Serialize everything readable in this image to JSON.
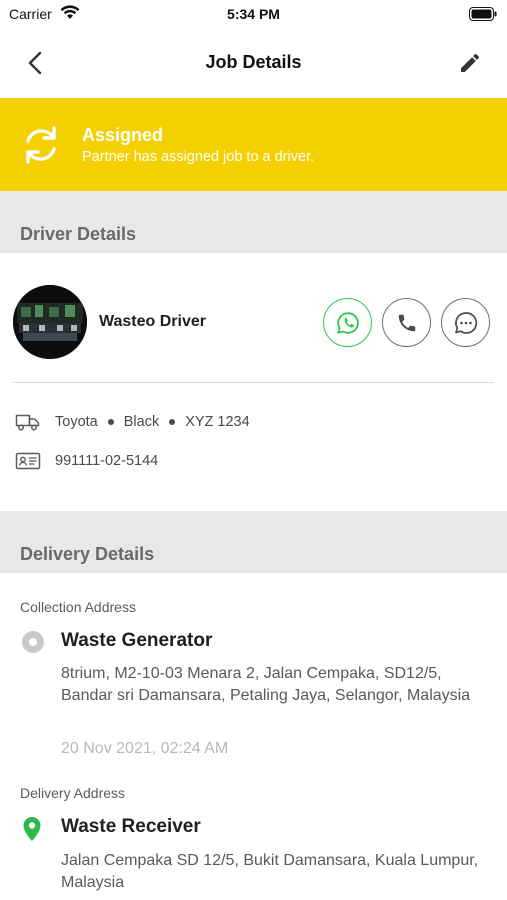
{
  "status_bar": {
    "carrier": "Carrier",
    "time": "5:34 PM"
  },
  "nav": {
    "title": "Job Details",
    "back_icon": "chevron-left-icon",
    "edit_icon": "pencil-icon"
  },
  "banner": {
    "title": "Assigned",
    "subtitle": "Partner has assigned job to a driver.",
    "color": "#f4d000",
    "icon": "refresh-icon"
  },
  "driver_section": {
    "heading": "Driver Details",
    "driver_name": "Wasteo Driver",
    "vehicle": {
      "make": "Toyota",
      "color": "Black",
      "plate": "XYZ 1234"
    },
    "id_number": "991111-02-5144",
    "actions": [
      "whatsapp-icon",
      "phone-icon",
      "chat-icon"
    ]
  },
  "delivery_section": {
    "heading": "Delivery Details",
    "collection": {
      "label": "Collection Address",
      "name": "Waste Generator",
      "address": "8trium, M2-10-03 Menara 2, Jalan Cempaka, SD12/5, Bandar sri Damansara,  Petaling Jaya, Selangor, Malaysia",
      "time": "20 Nov 2021, 02:24 AM"
    },
    "delivery": {
      "label": "Delivery Address",
      "name": "Waste Receiver",
      "address": "Jalan Cempaka SD 12/5,  Bukit Damansara, Kuala Lumpur, Malaysia"
    }
  }
}
